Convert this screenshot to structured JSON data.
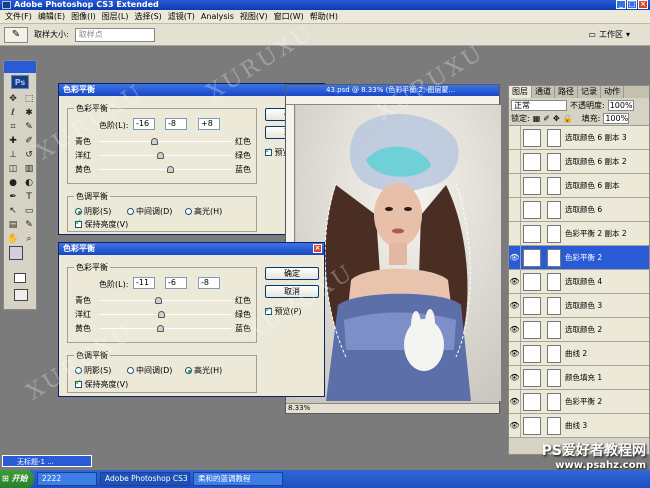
{
  "window": {
    "title": "Adobe Photoshop CS3 Extended"
  },
  "menu": [
    "文件(F)",
    "编辑(E)",
    "图像(I)",
    "图层(L)",
    "选择(S)",
    "滤镜(T)",
    "Analysis",
    "视图(V)",
    "窗口(W)",
    "帮助(H)"
  ],
  "options": {
    "sample_size_label": "取样大小:",
    "sample_value": "取样点",
    "workspace": "工作区"
  },
  "dialog1": {
    "title": "色彩平衡",
    "group1": "色彩平衡",
    "levels_label": "色阶(L):",
    "levels": [
      "-16",
      "-8",
      "+8"
    ],
    "sliders": [
      {
        "left": "青色",
        "right": "红色",
        "value": -16
      },
      {
        "left": "洋红",
        "right": "绿色",
        "value": -8
      },
      {
        "left": "黄色",
        "right": "蓝色",
        "value": 8
      }
    ],
    "group2": "色调平衡",
    "tones": [
      "阴影(S)",
      "中间调(D)",
      "高光(H)"
    ],
    "selected_tone": 0,
    "preserve": "保持亮度(V)",
    "ok": "确定",
    "cancel": "取消",
    "preview": "预览(P)"
  },
  "dialog2": {
    "title": "色彩平衡",
    "group1": "色彩平衡",
    "levels_label": "色阶(L):",
    "levels": [
      "-11",
      "-6",
      "-8"
    ],
    "sliders": [
      {
        "left": "青色",
        "right": "红色",
        "value": -11
      },
      {
        "left": "洋红",
        "right": "绿色",
        "value": -6
      },
      {
        "left": "黄色",
        "right": "蓝色",
        "value": -8
      }
    ],
    "group2": "色调平衡",
    "tones": [
      "阴影(S)",
      "中间调(D)",
      "高光(H)"
    ],
    "selected_tone": 2,
    "preserve": "保持亮度(V)",
    "ok": "确定",
    "cancel": "取消",
    "preview": "预览(P)"
  },
  "document": {
    "title": "43.psd @ 8.33% (色彩平衡 2, 图层蒙...",
    "zoom": "8.33%"
  },
  "layers": {
    "tabs": [
      "图层",
      "通道",
      "路径",
      "记录",
      "动作"
    ],
    "blend_mode": "正常",
    "opacity_label": "不透明度:",
    "opacity": "100%",
    "lock_label": "锁定:",
    "fill_label": "填充:",
    "fill": "100%",
    "items": [
      {
        "name": "选取颜色 6 副本 3",
        "visible": false,
        "selected": false
      },
      {
        "name": "选取颜色 6 副本 2",
        "visible": false,
        "selected": false
      },
      {
        "name": "选取颜色 6 副本",
        "visible": false,
        "selected": false
      },
      {
        "name": "选取颜色 6",
        "visible": false,
        "selected": false
      },
      {
        "name": "色彩平衡 2 副本 2",
        "visible": false,
        "selected": false
      },
      {
        "name": "色彩平衡 2",
        "visible": true,
        "selected": true
      },
      {
        "name": "选取颜色 4",
        "visible": true,
        "selected": false
      },
      {
        "name": "选取颜色 3",
        "visible": true,
        "selected": false
      },
      {
        "name": "选取颜色 2",
        "visible": true,
        "selected": false
      },
      {
        "name": "曲线 2",
        "visible": true,
        "selected": false
      },
      {
        "name": "颜色填充 1",
        "visible": true,
        "selected": false
      },
      {
        "name": "色彩平衡 2",
        "visible": true,
        "selected": false
      },
      {
        "name": "曲线 3",
        "visible": true,
        "selected": false
      }
    ]
  },
  "taskbar": {
    "start": "开始",
    "tasks": [
      "2222",
      "Adobe Photoshop CS3 E...",
      "柔和的蓝调教程"
    ]
  },
  "minidoc": "无标题-1 ...",
  "watermark": "XURUXU",
  "site": {
    "title": "PS爱好者教程网",
    "url": "www.psahz.com"
  }
}
